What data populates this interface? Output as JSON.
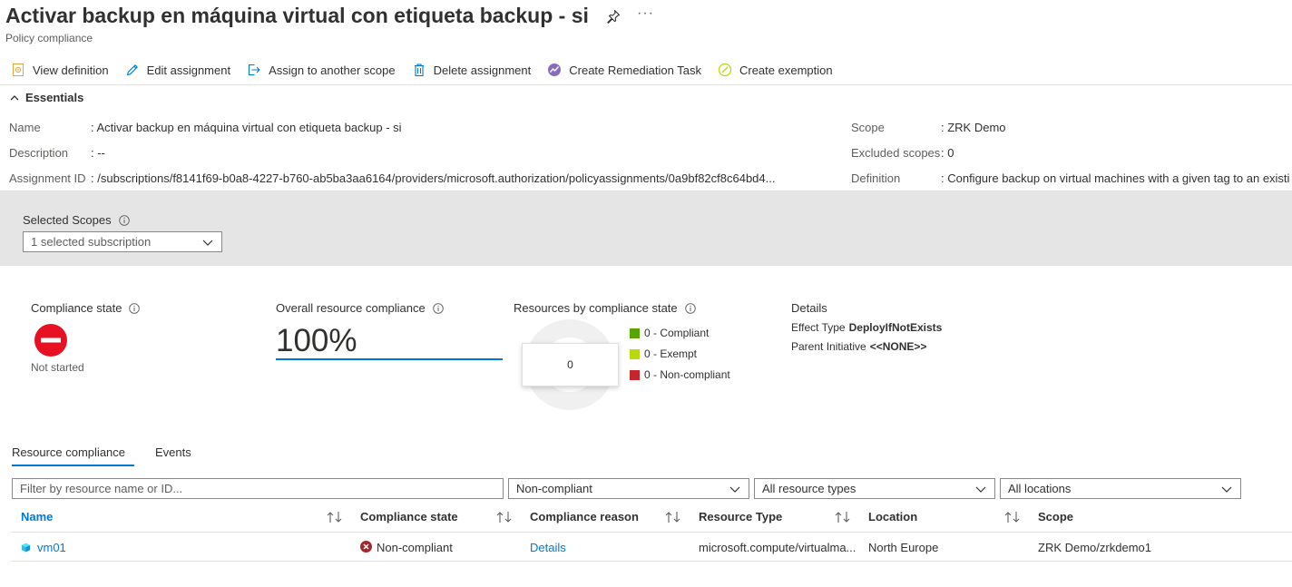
{
  "header": {
    "title": "Activar backup en máquina virtual con etiqueta backup - si",
    "subtitle": "Policy compliance",
    "more": "···"
  },
  "toolbar": {
    "view_definition": "View definition",
    "edit_assignment": "Edit assignment",
    "assign_scope": "Assign to another scope",
    "delete_assignment": "Delete assignment",
    "remediation_task": "Create Remediation Task",
    "create_exemption": "Create exemption"
  },
  "essentials": {
    "heading": "Essentials",
    "name_label": "Name",
    "name_value": ": Activar backup en máquina virtual con etiqueta backup - si",
    "description_label": "Description",
    "description_value": ": --",
    "assignment_id_label": "Assignment ID",
    "assignment_id_value": ": /subscriptions/f8141f69-b0a8-4227-b760-ab5ba3aa6164/providers/microsoft.authorization/policyassignments/0a9bf82cf8c64bd4...",
    "scope_label": "Scope",
    "scope_value": ": ZRK Demo",
    "excluded_label": "Excluded scopes",
    "excluded_value": ": 0",
    "definition_label": "Definition",
    "definition_value": ": Configure backup on virtual machines with a given tag to an existi"
  },
  "scopes": {
    "label": "Selected Scopes",
    "selected": "1 selected subscription"
  },
  "summary": {
    "compliance_state_label": "Compliance state",
    "compliance_state_value": "Not started",
    "overall_label": "Overall resource compliance",
    "overall_value": "100%",
    "by_state_label": "Resources by compliance state",
    "donut_total": "0",
    "legend": [
      {
        "label": "0 - Compliant",
        "color": "#57a300"
      },
      {
        "label": "0 - Exempt",
        "color": "#bad80a"
      },
      {
        "label": "0 - Non-compliant",
        "color": "#c4262e"
      }
    ],
    "details_title": "Details",
    "effect_type_label": "Effect Type",
    "effect_type_value": "DeployIfNotExists",
    "parent_initiative_label": "Parent Initiative",
    "parent_initiative_value": "<<NONE>>"
  },
  "tabs": {
    "resource_compliance": "Resource compliance",
    "events": "Events"
  },
  "filters": {
    "search_placeholder": "Filter by resource name or ID...",
    "compliance": "Non-compliant",
    "resource_types": "All resource types",
    "locations": "All locations"
  },
  "table": {
    "columns": {
      "name": "Name",
      "compliance_state": "Compliance state",
      "compliance_reason": "Compliance reason",
      "resource_type": "Resource Type",
      "location": "Location",
      "scope": "Scope"
    },
    "rows": [
      {
        "name": "vm01",
        "compliance_state": "Non-compliant",
        "compliance_reason": "Details",
        "resource_type": "microsoft.compute/virtualma...",
        "location": "North Europe",
        "scope": "ZRK Demo/zrkdemo1"
      }
    ]
  },
  "colors": {
    "accent": "#0078d4",
    "error": "#c4262e",
    "compliant": "#57a300",
    "exempt": "#bad80a"
  }
}
